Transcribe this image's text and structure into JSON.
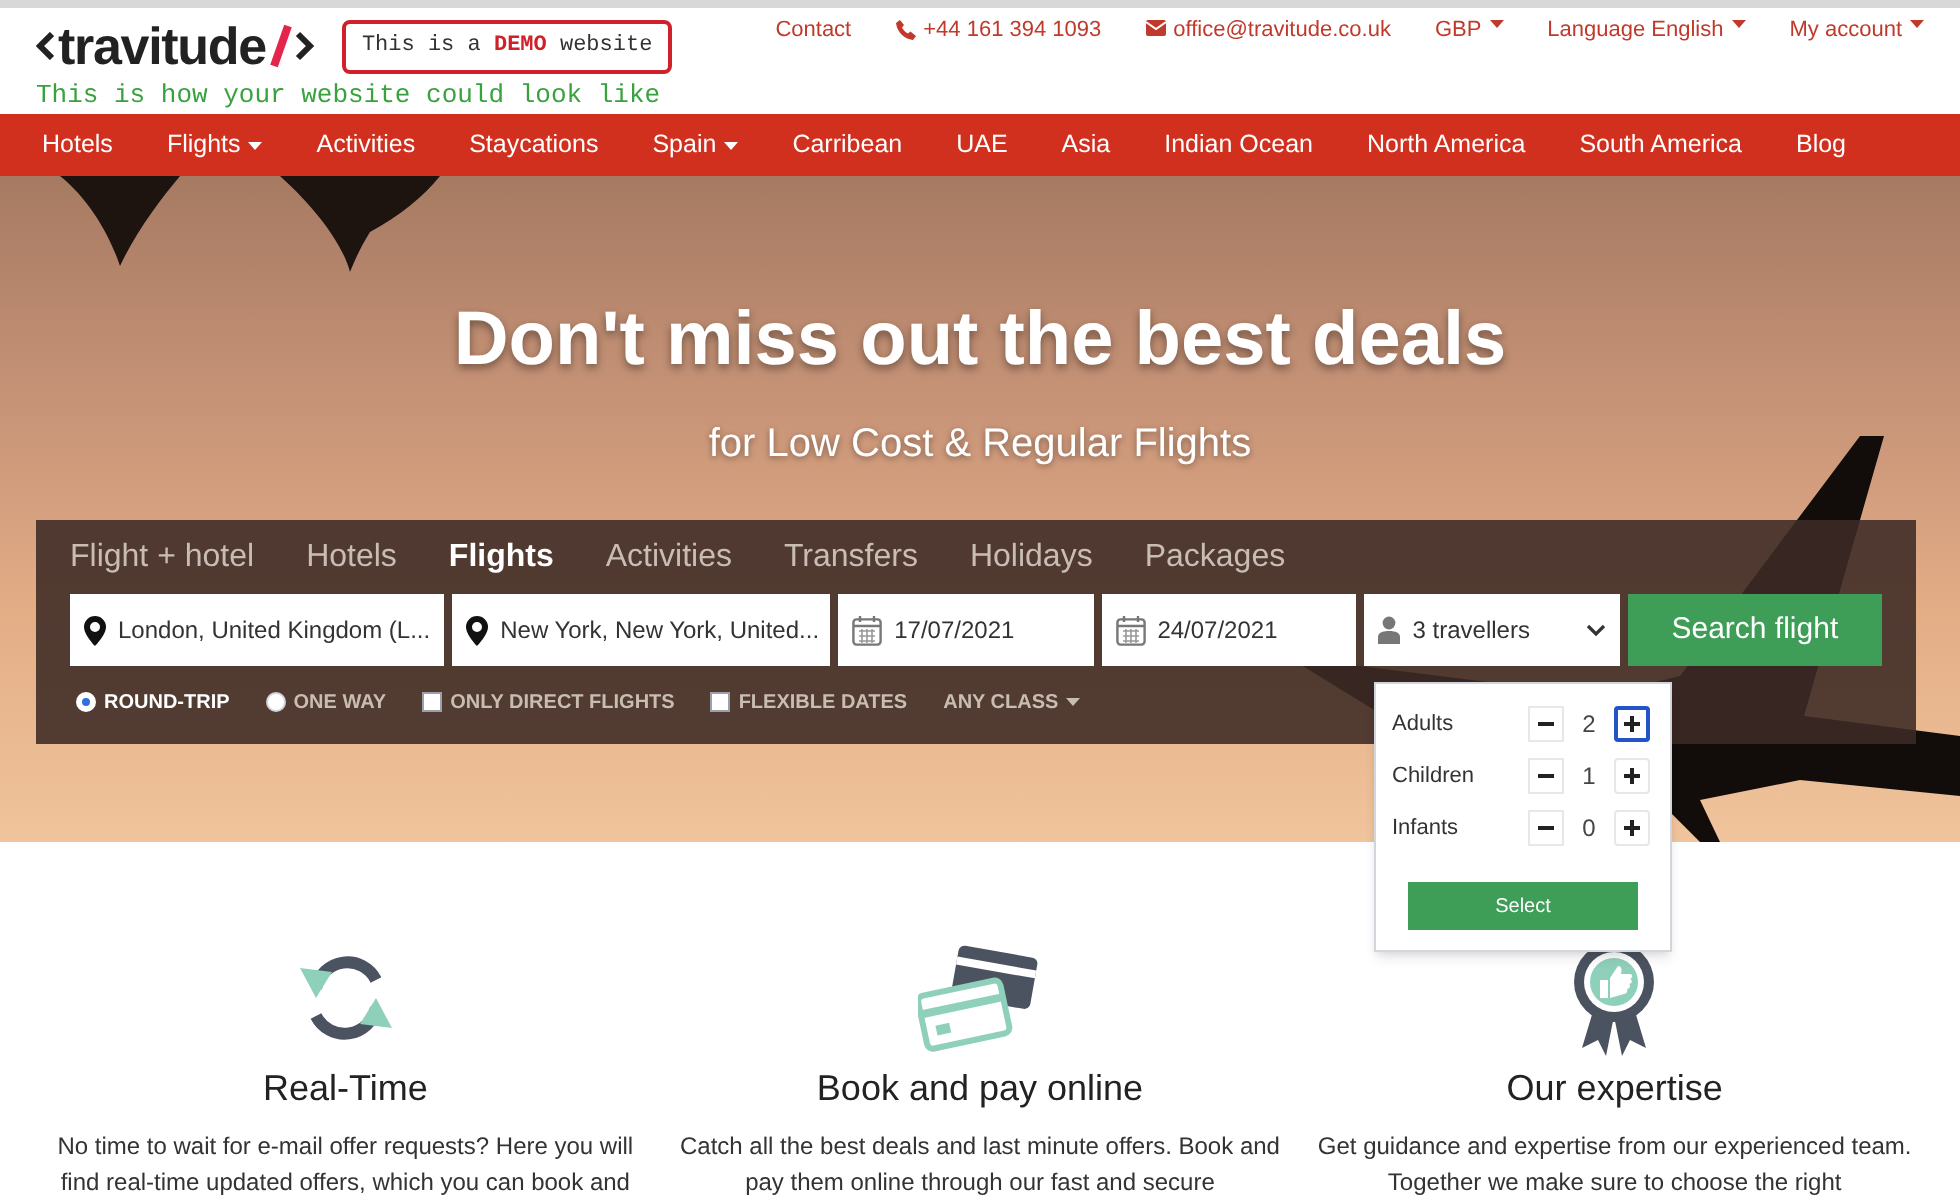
{
  "header": {
    "logo": {
      "text": "travitude"
    },
    "demo_badge": "This is a **DEMO** website",
    "tagline": "This is how your website could look like",
    "top_links": [
      {
        "kind": "plain",
        "label": "Contact",
        "dropdown": false
      },
      {
        "kind": "phone",
        "label": "+44 161 394 1093",
        "dropdown": false
      },
      {
        "kind": "email",
        "label": "office@travitude.co.uk",
        "dropdown": false
      },
      {
        "kind": "plain",
        "label": "GBP",
        "dropdown": true
      },
      {
        "kind": "plain",
        "label": "Language English",
        "dropdown": true
      },
      {
        "kind": "plain",
        "label": "My account",
        "dropdown": true
      }
    ]
  },
  "nav": [
    {
      "label": "Hotels",
      "dropdown": false
    },
    {
      "label": "Flights",
      "dropdown": true
    },
    {
      "label": "Activities",
      "dropdown": false
    },
    {
      "label": "Staycations",
      "dropdown": false
    },
    {
      "label": "Spain",
      "dropdown": true
    },
    {
      "label": "Carribean",
      "dropdown": false
    },
    {
      "label": "UAE",
      "dropdown": false
    },
    {
      "label": "Asia",
      "dropdown": false
    },
    {
      "label": "Indian Ocean",
      "dropdown": false
    },
    {
      "label": "North America",
      "dropdown": false
    },
    {
      "label": "South America",
      "dropdown": false
    },
    {
      "label": "Blog",
      "dropdown": false
    }
  ],
  "hero": {
    "title": "Don't miss out the best deals",
    "subtitle": "for Low Cost & Regular Flights"
  },
  "search": {
    "tabs": [
      {
        "label": "Flight + hotel",
        "selected": false
      },
      {
        "label": "Hotels",
        "selected": false
      },
      {
        "label": "Flights",
        "selected": true
      },
      {
        "label": "Activities",
        "selected": false
      },
      {
        "label": "Transfers",
        "selected": false
      },
      {
        "label": "Holidays",
        "selected": false
      },
      {
        "label": "Packages",
        "selected": false
      }
    ],
    "fields": [
      {
        "kind": "location",
        "value": "London, United Kingdom (L..."
      },
      {
        "kind": "location",
        "value": "New York, New York, United..."
      },
      {
        "kind": "date",
        "value": "17/07/2021"
      },
      {
        "kind": "date",
        "value": "24/07/2021"
      },
      {
        "kind": "travellers",
        "value": "3 travellers"
      }
    ],
    "button": "Search flight",
    "options": [
      {
        "kind": "radio",
        "label": "ROUND-TRIP",
        "checked": true
      },
      {
        "kind": "radio",
        "label": "ONE WAY",
        "checked": false
      },
      {
        "kind": "checkbox",
        "label": "ONLY DIRECT FLIGHTS",
        "checked": false
      },
      {
        "kind": "checkbox",
        "label": "FLEXIBLE DATES",
        "checked": false
      },
      {
        "kind": "dropdown",
        "label": "ANY CLASS"
      }
    ],
    "travellers_popup": {
      "rows": [
        {
          "label": "Adults",
          "value": "2",
          "plus_focused": true
        },
        {
          "label": "Children",
          "value": "1",
          "plus_focused": false
        },
        {
          "label": "Infants",
          "value": "0",
          "plus_focused": false
        }
      ],
      "button": "Select"
    }
  },
  "features": [
    {
      "kind": "refresh",
      "title": "Real-Time",
      "text": "No time to wait for e-mail offer requests? Here you will find real-time updated offers, which you can book and"
    },
    {
      "kind": "cards",
      "title": "Book and pay online",
      "text": "Catch all the best deals and last minute offers. Book and pay them online through our fast and secure"
    },
    {
      "kind": "award",
      "title": "Our expertise",
      "text": "Get guidance and expertise from our experienced team. Together we make sure to choose the right"
    }
  ]
}
